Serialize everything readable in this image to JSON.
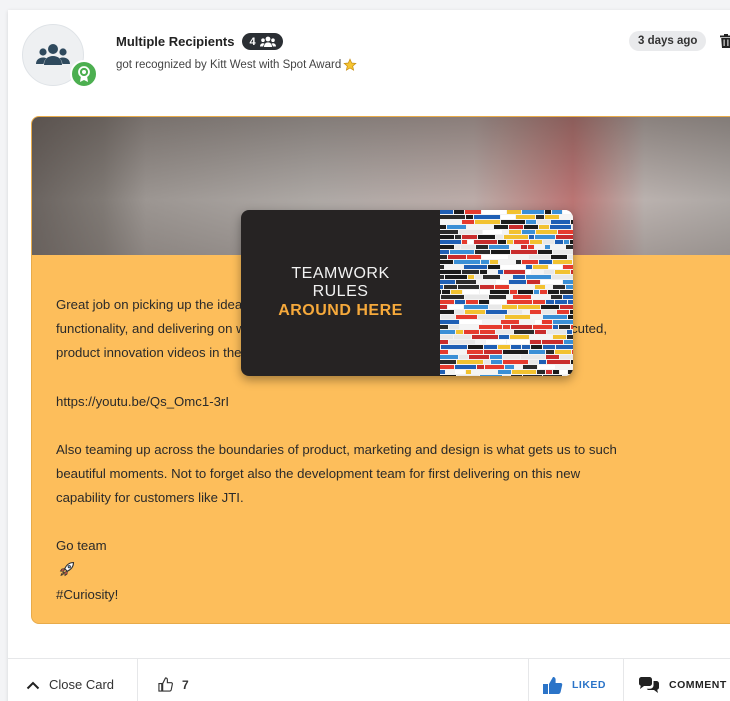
{
  "header": {
    "title": "Multiple Recipients",
    "recipient_count": "4",
    "subtitle": "got recognized by Kitt West with Spot Award",
    "time_ago": "3 days ago",
    "icons": {
      "avatar": "group-icon",
      "award_badge": "ribbon-award-icon",
      "star": "star-icon",
      "delete": "trash-icon"
    }
  },
  "award": {
    "line1": "TEAMWORK",
    "line2": "RULES",
    "line3": "AROUND HERE",
    "panel_color": "#fdbe5b",
    "accent_color": "#f6a93b"
  },
  "message": {
    "paragraphs": [
      "Great job on picking up the idea to create an external facing videos for the new Nudges\nfunctionality, and delivering on what hopefully will be many more such professionally executed,\nproduct innovation videos in the near future.",
      "https://youtu.be/Qs_Omc1-3rI",
      "Also teaming up across the boundaries of product, marketing and design is what gets us to such\nbeautiful moments.  Not to forget also the development team for first delivering on this new\ncapability for customers like JTI.",
      "Go team",
      "#Curiosity!"
    ]
  },
  "footer": {
    "close_label": "Close Card",
    "like_count": "7",
    "liked_label": "LIKED",
    "comment_label": "COMMENT",
    "liked_color": "#2b74c8"
  }
}
